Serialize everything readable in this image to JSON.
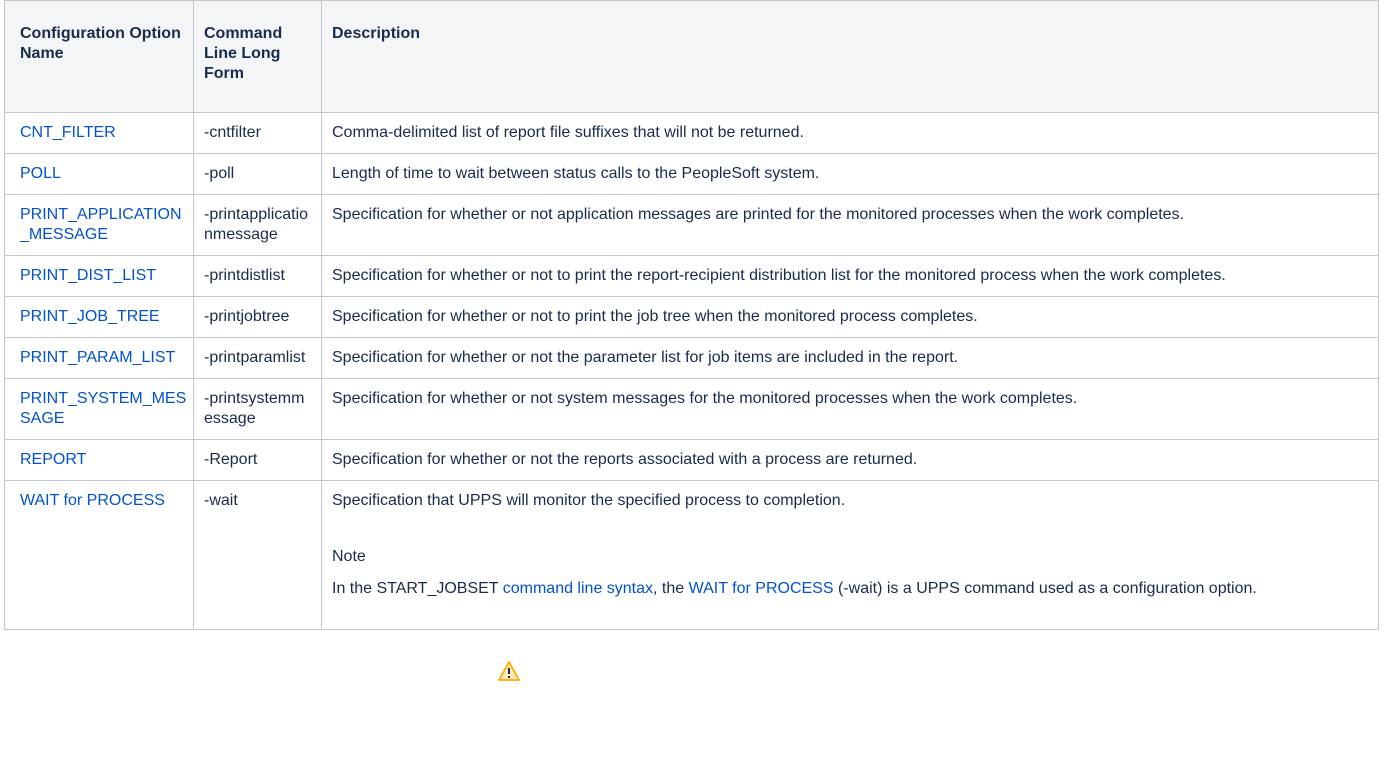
{
  "headers": {
    "name": "Configuration Option Name",
    "cmd": "Command Line Long Form",
    "desc": "Description"
  },
  "rows": [
    {
      "name": "CNT_FILTER",
      "cmd": "-cntfilter",
      "desc": "Comma-delimited list of report file suffixes that will not be returned."
    },
    {
      "name": "POLL",
      "cmd": "-poll",
      "desc": "Length of time to wait between status calls to the PeopleSoft system."
    },
    {
      "name": "PRINT_APPLICATION_MESSAGE",
      "cmd": "-printapplicationmessage",
      "desc": "Specification for whether or not application messages are printed for the monitored processes when the work completes."
    },
    {
      "name": "PRINT_DIST_LIST",
      "cmd": "-printdistlist",
      "desc": "Specification for whether or not to print the report-recipient distribution list for the monitored process when the work completes."
    },
    {
      "name": "PRINT_JOB_TREE",
      "cmd": "-printjobtree",
      "desc": "Specification for whether or not to print the job tree when the monitored process completes."
    },
    {
      "name": "PRINT_PARAM_LIST",
      "cmd": "-printparamlist",
      "desc": "Specification for whether or not the parameter list for job items are included in the report."
    },
    {
      "name": "PRINT_SYSTEM_MESSAGE",
      "cmd": "-printsystemmessage",
      "desc": "Specification for whether or not system messages for the monitored processes when the work completes."
    },
    {
      "name": "REPORT",
      "cmd": "-Report",
      "desc": "Specification for whether or not the reports associated with a process are returned."
    },
    {
      "name": "WAIT for PROCESS",
      "cmd": "-wait",
      "desc": "Specification that UPPS will monitor the specified process to completion."
    }
  ],
  "note": {
    "title": "Note",
    "text_before": "In the START_JOBSET ",
    "link1": "command line syntax",
    "text_mid": ", the ",
    "link2": "WAIT for PROCESS",
    "text_after": " (-wait) is a UPPS command used as a configuration option."
  },
  "colors": {
    "link": "#0052cc",
    "header_bg": "#f4f5f7",
    "border": "#c1c7d0",
    "warning": "#ffab00"
  },
  "icons": {
    "note": "warning-icon"
  }
}
